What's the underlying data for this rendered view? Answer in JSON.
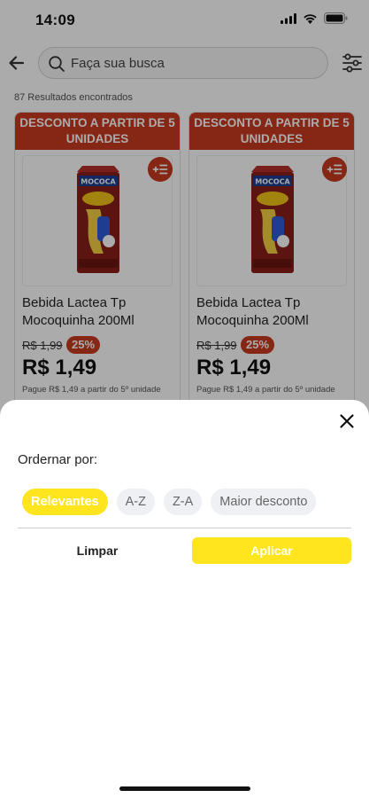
{
  "status_bar": {
    "time": "14:09"
  },
  "search": {
    "placeholder": "Faça sua busca"
  },
  "results": {
    "count_text": "87 Resultados encontrados"
  },
  "products": [
    {
      "banner": "DESCONTO A PARTIR DE 5 UNIDADES",
      "name": "Bebida Lactea Tp Mocoquinha 200Ml",
      "old_price": "R$ 1,99",
      "discount": "25%",
      "price": "R$ 1,49",
      "price_note": "Pague R$ 1,49 a partir do 5º unidade",
      "brand_text": "MOCOCA"
    },
    {
      "banner": "DESCONTO A PARTIR DE 5 UNIDADES",
      "name": "Bebida Lactea Tp Mocoquinha 200Ml",
      "old_price": "R$ 1,99",
      "discount": "25%",
      "price": "R$ 1,49",
      "price_note": "Pague R$ 1,49 a partir do 5º unidade",
      "brand_text": "MOCOCA"
    }
  ],
  "sort_sheet": {
    "title": "Ordernar por:",
    "options": [
      "Relevantes",
      "A-Z",
      "Z-A",
      "Maior desconto"
    ],
    "selected": "Relevantes",
    "clear_label": "Limpar",
    "apply_label": "Aplicar"
  },
  "colors": {
    "accent_yellow": "#ffe51e",
    "discount_red": "#c8391f",
    "overlay": "rgba(0,0,0,0.33)"
  },
  "icons": {
    "back": "arrow-left-icon",
    "search": "search-icon",
    "filter": "sliders-icon",
    "add_to_list": "add-list-icon",
    "close": "close-icon"
  }
}
